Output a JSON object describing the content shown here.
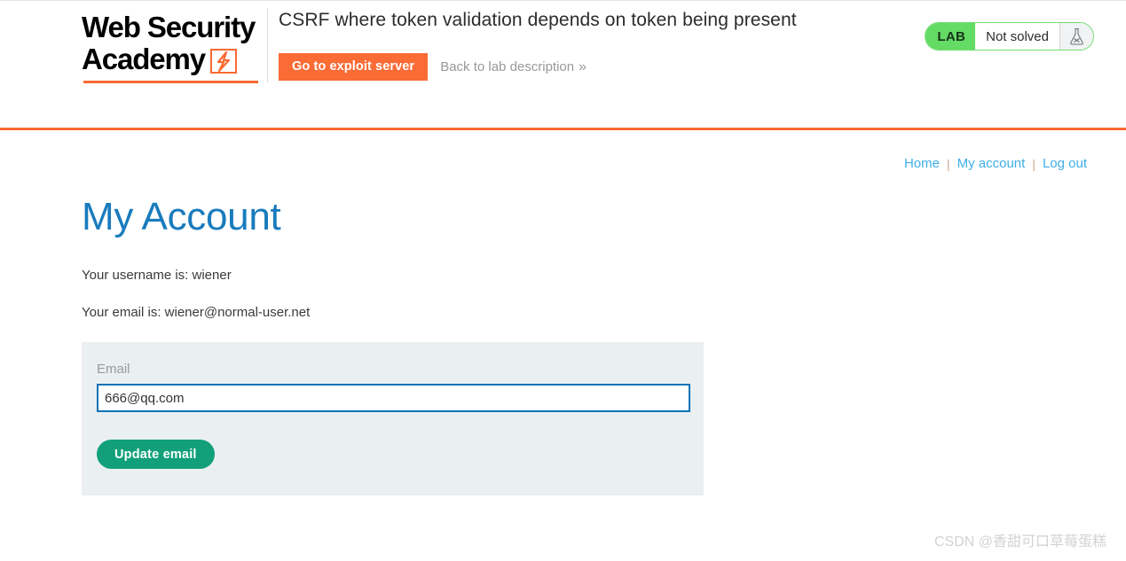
{
  "header": {
    "logo": {
      "line1": "Web Security",
      "line2": "Academy",
      "mark_icon": "lightning-bolt-icon"
    },
    "lab_title": "CSRF where token validation depends on token being present",
    "exploit_button": "Go to exploit server",
    "back_link": "Back to lab description",
    "back_chevron": "»",
    "status": {
      "tag": "LAB",
      "state": "Not solved",
      "flask_icon": "flask-icon",
      "tag_color": "#64db64",
      "border_color": "#6fdd6f"
    },
    "accent_color": "#f96a33"
  },
  "page_nav": {
    "items": [
      {
        "label": "Home"
      },
      {
        "label": "My account"
      },
      {
        "label": "Log out"
      }
    ],
    "separator": "|",
    "link_color": "#3eaee8"
  },
  "main": {
    "title": "My Account",
    "title_color": "#197bbd",
    "username_line": "Your username is: wiener",
    "email_line": "Your email is: wiener@normal-user.net",
    "form": {
      "email_label": "Email",
      "email_value": "666@qq.com",
      "email_placeholder": "",
      "submit_label": "Update email",
      "submit_color": "#11a07a",
      "panel_color": "#eaeff1",
      "input_border_color": "#0b72b5"
    }
  },
  "watermark": {
    "text": "CSDN @香甜可口草莓蛋糕"
  }
}
